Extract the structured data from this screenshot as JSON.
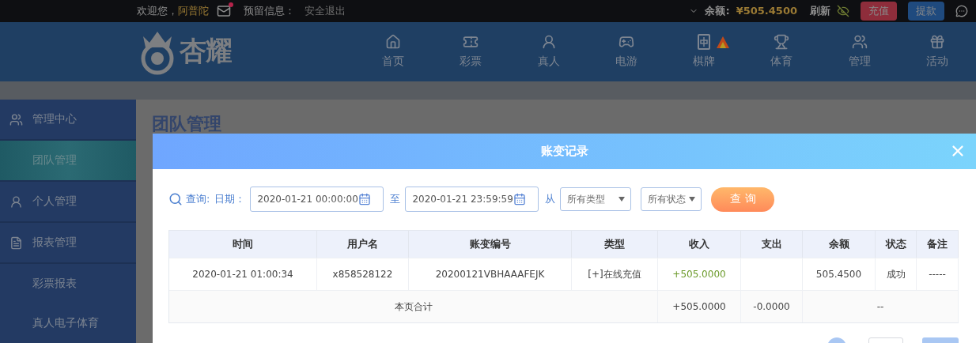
{
  "top_bar": {
    "greeting": "欢迎您，",
    "username": "阿普陀",
    "mail_unread": true,
    "reserved_info_label": "预留信息：",
    "logout": "安全退出",
    "balance_label": "余额:",
    "balance": "¥505.4500",
    "refresh": "刷新",
    "deposit": "充值",
    "withdraw": "提款"
  },
  "logo": {
    "text": "杏耀"
  },
  "nav": [
    {
      "label": "首页",
      "kind": "home",
      "badge": false
    },
    {
      "label": "彩票",
      "kind": "ticket",
      "badge": false
    },
    {
      "label": "真人",
      "kind": "person",
      "badge": false
    },
    {
      "label": "电游",
      "kind": "slot",
      "badge": false
    },
    {
      "label": "棋牌",
      "kind": "tile",
      "badge": true
    },
    {
      "label": "体育",
      "kind": "trophy",
      "badge": false
    },
    {
      "label": "管理",
      "kind": "users",
      "badge": false
    },
    {
      "label": "活动",
      "kind": "gift",
      "badge": false
    }
  ],
  "sidebar": {
    "groups": [
      {
        "label": "管理中心",
        "kind": "users",
        "children": [
          {
            "label": "团队管理",
            "selected": true
          }
        ]
      },
      {
        "label": "个人管理",
        "kind": "person"
      },
      {
        "label": "报表管理",
        "kind": "file",
        "children": [
          {
            "label": "彩票报表",
            "selected": false
          },
          {
            "label": "真人电子体育",
            "selected": false
          }
        ]
      }
    ]
  },
  "page_title": "团队管理",
  "modal": {
    "title": "账变记录",
    "filters": {
      "query_label": "查询:",
      "date_label": "日期：",
      "start": "2020-01-21 00:00:00",
      "to": "至",
      "end": "2020-01-21 23:59:59",
      "from": "从",
      "type_select": "所有类型",
      "status_select": "所有状态",
      "button": "查 询"
    },
    "table": {
      "columns": [
        "时间",
        "用户名",
        "账变编号",
        "类型",
        "收入",
        "支出",
        "余额",
        "状态",
        "备注"
      ],
      "rows": [
        {
          "time": "2020-01-21 01:00:34",
          "user": "x858528122",
          "id": "20200121VBHAAAFEJK",
          "type": "[+]在线充值",
          "income": "+505.0000",
          "expense": "",
          "balance": "505.4500",
          "status": "成功",
          "note": "-----"
        }
      ],
      "total": {
        "label": "本页合计",
        "income": "+505.0000",
        "expense": "-0.0000",
        "rest": "--"
      }
    }
  }
}
